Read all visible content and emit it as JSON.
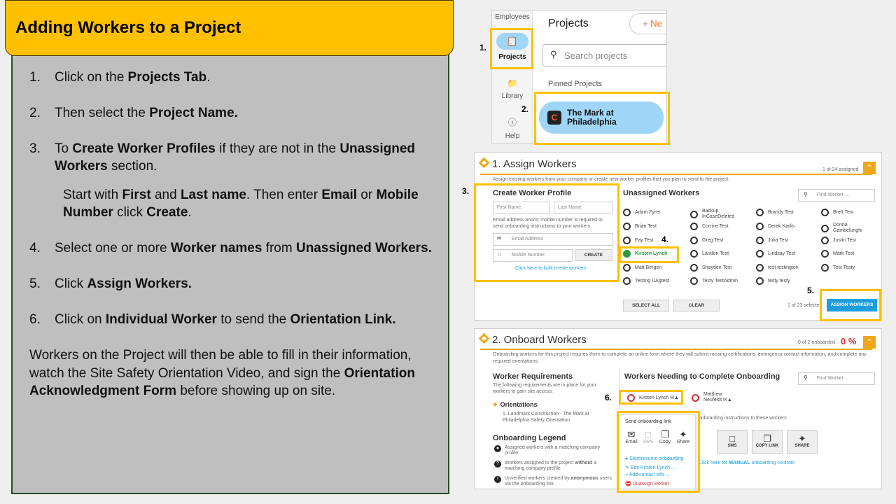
{
  "title": "Adding Workers to a Project",
  "steps": [
    {
      "num": "1.",
      "html_parts": [
        "Click on the ",
        "Projects Tab",
        "."
      ]
    },
    {
      "num": "2.",
      "html_parts": [
        "Then select the ",
        "Project Name.",
        ""
      ]
    },
    {
      "num": "3.",
      "html_parts": [
        "To ",
        "Create Worker Profiles",
        " if they are not in the ",
        "Unassigned Workers",
        " section."
      ]
    },
    {
      "num": "4.",
      "html_parts": [
        "Select one or more ",
        "Worker names",
        " from ",
        "Unassigned Workers.",
        ""
      ]
    },
    {
      "num": "5.",
      "html_parts": [
        "Click ",
        "Assign Workers.",
        ""
      ]
    },
    {
      "num": "6.",
      "html_parts": [
        "Click on ",
        "Individual Worker",
        " to send the ",
        "Orientation Link.",
        ""
      ]
    }
  ],
  "sub_step": [
    "Start with ",
    "First",
    " and ",
    "Last name",
    ". Then enter ",
    "Email",
    " or ",
    "Mobile Number",
    " click ",
    "Create",
    "."
  ],
  "closing": [
    "Workers on the Project will then be able to fill in their information, watch the Site Safety Orientation Video, and sign the  ",
    "Orientation Acknowledgment Form",
    " before showing up on site."
  ],
  "callouts": {
    "c1": "1.",
    "c2": "2.",
    "c3": "3.",
    "c4": "4.",
    "c5": "5.",
    "c6": "6."
  },
  "projects_panel": {
    "nav_employees": "Employees",
    "nav_projects": "Projects",
    "nav_library": "Library",
    "nav_help": "Help",
    "title": "Projects",
    "new_label": "Ne",
    "search_placeholder": "Search projects",
    "pinned_label": "Pinned Projects",
    "project_name_line1": "The Mark at",
    "project_name_line2": "Philadelphia"
  },
  "assign_panel": {
    "title": "1. Assign Workers",
    "assigned_count": "1 of 24 assigned",
    "intro": "Assign existing workers from your company or create new worker profiles that you plan to send to the project.",
    "form_title": "Create Worker Profile",
    "first_name_ph": "First Name",
    "last_name_ph": "Last Name",
    "form_note": "Email address and/or mobile number is required to send onboarding instructions to your workers.",
    "email_ph": "Email Address",
    "mobile_ph": "Mobile Number",
    "create_label": "CREATE",
    "bulk_link": "Click here to bulk create workers",
    "unassigned_title": "Unassigned Workers",
    "find_ph": "Find Worker ...",
    "workers": [
      [
        "Adam Fyrer",
        "Backup InCaseDeleted",
        "Brandy Test",
        "Brett Test"
      ],
      [
        "Brian Test",
        "Corrine Test",
        "Derek Kadis",
        "Donna Gambelunghi"
      ],
      [
        "Fay Test",
        "Greg Test",
        "Julia Test",
        "Justin Test"
      ],
      [
        "Kirsten Lynch",
        "Landon Test",
        "Lindsay Test",
        "Mark Test"
      ],
      [
        "Matt Bergen",
        "Shayden Test",
        "test testington",
        "Test Testy"
      ],
      [
        "Testing UAgtest",
        "Testy TestAdmin",
        "testy testy",
        ""
      ]
    ],
    "select_all": "SELECT ALL",
    "clear": "CLEAR",
    "selected_count": "1 of 23 selecte",
    "assign_btn": "ASSIGN WORKERS"
  },
  "onboard_panel": {
    "title": "2. Onboard Workers",
    "onboarded": "0 of 2 onboarded",
    "percent": "0 %",
    "intro": "Onboarding workers for this project requires them to complete an online form where they will submit missing certifications, emergency contact information, and complete any required orientations.",
    "req_title": "Worker Requirements",
    "req_text": "The following requirements are in place for your workers to gain site access.",
    "orient_title": "Orientations",
    "orient_item": "1. Landmark Construction - The Mark at Philadelphia Safety Orientation",
    "legend_title": "Onboarding Legend",
    "legend_1": "Assigned workers with a matching company profile",
    "legend_2a": "Workers assigned to the project ",
    "legend_2b": "without",
    "legend_2c": " a matching company profile",
    "legend_3a": "Unverified workers created by ",
    "legend_3b": "anonymous",
    "legend_3c": " users via the onboarding link",
    "need_title": "Workers Needing to Complete Onboarding",
    "find_ph": "Find Worker ...",
    "worker_1": "Kirsten Lynch",
    "worker_2a": "Matthew",
    "worker_2b": "Neufeldt",
    "send_instr": "onboarding instructions to these workers",
    "popup_title": "Send onboarding link",
    "pop_email": "Email",
    "pop_sms": "SMS",
    "pop_copy": "Copy",
    "pop_share": "Share",
    "pop_start": "Start/resume onboarding",
    "pop_edit": "Edit Kirsten Lynch ...",
    "pop_add": "Add contact info ...",
    "pop_unassign": "Unassign worker",
    "btn_sms": "SMS",
    "btn_copy": "COPY LINK",
    "btn_share": "SHARE",
    "manual_a": "Click here for ",
    "manual_b": "MANUAL",
    "manual_c": " onboarding controls"
  },
  "colors": {
    "accent": "#ffc000",
    "panel": "#bfbfbf",
    "link": "#1a9ee0",
    "danger": "#e03030",
    "orange": "#f0a818"
  }
}
